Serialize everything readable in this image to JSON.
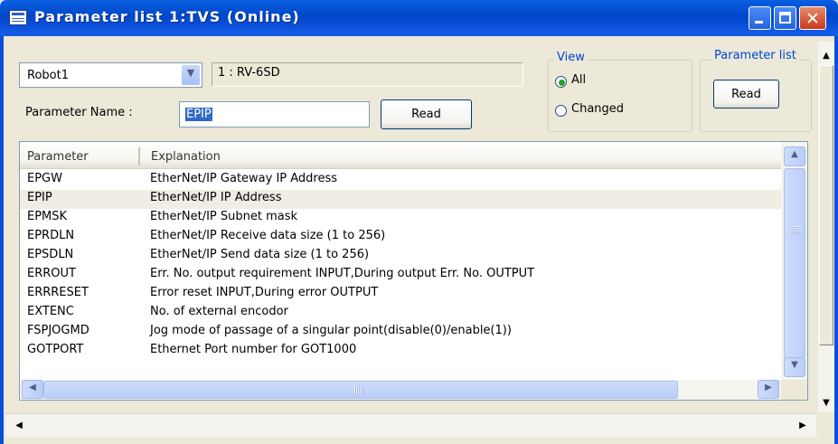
{
  "window": {
    "title": "Parameter list 1:TVS (Online)",
    "controls": {
      "minimize": "",
      "maximize": "",
      "close": "✕"
    }
  },
  "robot": {
    "selected": "Robot1",
    "model": "1 : RV-6SD"
  },
  "parameter_name": {
    "label": "Parameter Name :",
    "value": "EPIP",
    "read_label": "Read"
  },
  "view": {
    "legend": "View",
    "options": [
      {
        "label": "All",
        "selected": true
      },
      {
        "label": "Changed",
        "selected": false
      }
    ]
  },
  "parameter_list": {
    "legend": "Parameter list",
    "read_label": "Read"
  },
  "table": {
    "columns": [
      "Parameter",
      "Explanation"
    ],
    "rows": [
      {
        "parameter": "EPGW",
        "explanation": "EtherNet/IP Gateway IP Address"
      },
      {
        "parameter": "EPIP",
        "explanation": "EtherNet/IP IP Address",
        "selected": true
      },
      {
        "parameter": "EPMSK",
        "explanation": "EtherNet/IP Subnet mask"
      },
      {
        "parameter": "EPRDLN",
        "explanation": "EtherNet/IP Receive data size (1 to 256)"
      },
      {
        "parameter": "EPSDLN",
        "explanation": "EtherNet/IP Send data size (1 to 256)"
      },
      {
        "parameter": "ERROUT",
        "explanation": "Err. No. output requirement INPUT,During output Err. No. OUTPUT"
      },
      {
        "parameter": "ERRRESET",
        "explanation": "Error reset INPUT,During error OUTPUT"
      },
      {
        "parameter": "EXTENC",
        "explanation": "No. of external encodor"
      },
      {
        "parameter": "FSPJOGMD",
        "explanation": "Jog mode of passage of a singular point(disable(0)/enable(1))"
      },
      {
        "parameter": "GOTPORT",
        "explanation": "Ethernet Port number for GOT1000"
      }
    ]
  },
  "colors": {
    "titlebar": "#0a4fd8",
    "window_bg": "#ece9d8",
    "group_legend": "#0046d5",
    "selection": "#316ac5"
  },
  "icons": {
    "app": "parameter-list-icon",
    "dropdown": "chevron-down-icon",
    "scroll_up": "arrow-up-icon",
    "scroll_down": "arrow-down-icon",
    "scroll_left": "arrow-left-icon",
    "scroll_right": "arrow-right-icon"
  }
}
